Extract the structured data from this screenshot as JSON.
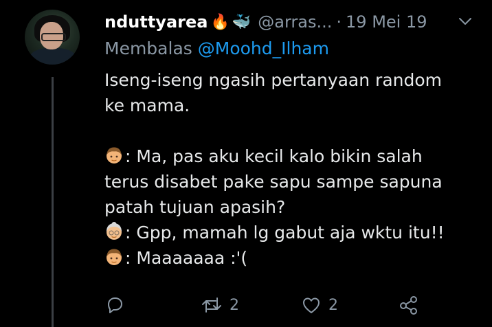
{
  "tweet": {
    "display_name": "nduttyarea",
    "name_emojis": [
      "🔥",
      "🐳"
    ],
    "handle": "@arras...",
    "separator": "·",
    "date": "19 Mei 19",
    "reply_prefix": "Membalas",
    "reply_to": "@Moohd_Ilham",
    "lines": [
      {
        "emoji": "",
        "text": "Iseng-iseng ngasih pertanyaan random"
      },
      {
        "emoji": "",
        "text": "ke mama."
      },
      {
        "emoji": "",
        "text": ""
      },
      {
        "emoji": "boy-face-emoji",
        "text": ": Ma, pas aku kecil kalo bikin salah"
      },
      {
        "emoji": "",
        "text": "terus disabet pake sapu sampe sapuna"
      },
      {
        "emoji": "",
        "text": "patah tujuan apasih?"
      },
      {
        "emoji": "older-woman-face-emoji",
        "text": ": Gpp, mamah lg gabut aja wktu itu!!"
      },
      {
        "emoji": "boy-face-emoji",
        "text": ": Maaaaaaa :'("
      }
    ],
    "actions": {
      "reply": {
        "icon": "reply-icon",
        "count": ""
      },
      "retweet": {
        "icon": "retweet-icon",
        "count": "2"
      },
      "like": {
        "icon": "heart-icon",
        "count": "2"
      },
      "share": {
        "icon": "share-icon",
        "count": ""
      }
    }
  },
  "colors": {
    "background": "#000000",
    "primary_text": "#e7e9ea",
    "secondary_text": "#8b98a5",
    "mention": "#1d9bf0"
  }
}
